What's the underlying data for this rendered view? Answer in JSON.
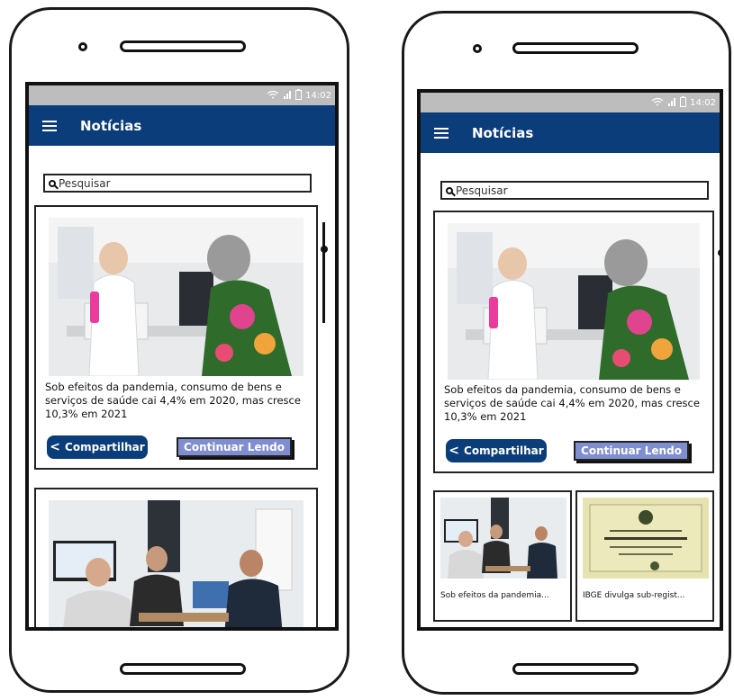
{
  "colors": {
    "brand": "#0b3d7a"
  },
  "status": {
    "time": "14:02",
    "icons": [
      "wifi-icon",
      "signal-icon",
      "battery-icon"
    ]
  },
  "appbar": {
    "title": "Notícias",
    "menu_icon": "hamburger-menu-icon"
  },
  "search": {
    "placeholder": "Pesquisar"
  },
  "featured": {
    "headline": "Sob efeitos da pandemia, consumo de bens e serviços de saúde cai 4,4% em 2020, mas cresce 10,3% em 2021",
    "share_label": "Compartilhar",
    "continue_label": "Continuar Lendo"
  },
  "grid": {
    "items": [
      {
        "caption": "Sob efeitos da pandemia..."
      },
      {
        "caption": "IBGE divulga sub-regist..."
      }
    ]
  }
}
